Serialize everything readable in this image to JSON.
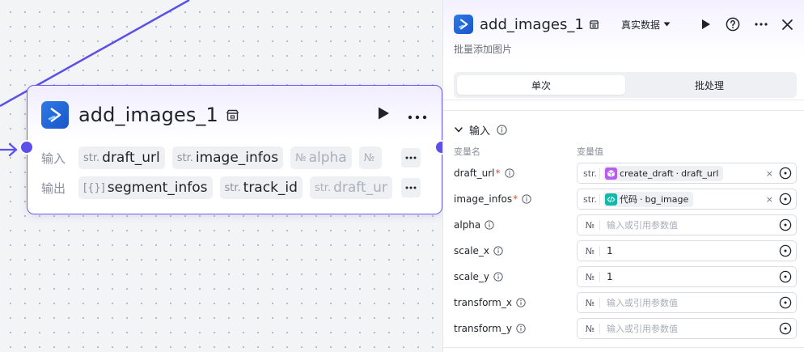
{
  "canvas": {
    "node": {
      "title": "add_images_1",
      "input_label": "输入",
      "output_label": "输出",
      "inputs": [
        {
          "type": "str.",
          "name": "draft_url"
        },
        {
          "type": "str.",
          "name": "image_infos"
        },
        {
          "type": "№",
          "name": "alpha"
        },
        {
          "type": "№",
          "name": ""
        }
      ],
      "outputs": [
        {
          "type": "[{}]",
          "name": "segment_infos"
        },
        {
          "type": "str.",
          "name": "track_id"
        },
        {
          "type": "str.",
          "name": "draft_ur"
        }
      ]
    }
  },
  "panel": {
    "title": "add_images_1",
    "subtitle": "批量添加图片",
    "data_mode": "真实数据",
    "tabs": [
      {
        "label": "单次",
        "active": true
      },
      {
        "label": "批处理",
        "active": false
      }
    ],
    "section_title": "输入",
    "col_name": "变量名",
    "col_value": "变量值",
    "params": [
      {
        "name": "draft_url",
        "required": true,
        "type": "str.",
        "kind": "ref",
        "ref_source": "create_draft",
        "ref_var": "draft_url",
        "ref_icon": "cube-icon",
        "ref_color": "#b85cf0"
      },
      {
        "name": "image_infos",
        "required": true,
        "type": "str.",
        "kind": "ref",
        "ref_source": "代码",
        "ref_var": "bg_image",
        "ref_icon": "code-icon",
        "ref_color": "#14b8a6"
      },
      {
        "name": "alpha",
        "required": false,
        "type": "№",
        "kind": "empty",
        "placeholder": "输入或引用参数值"
      },
      {
        "name": "scale_x",
        "required": false,
        "type": "№",
        "kind": "value",
        "value": "1"
      },
      {
        "name": "scale_y",
        "required": false,
        "type": "№",
        "kind": "value",
        "value": "1"
      },
      {
        "name": "transform_x",
        "required": false,
        "type": "№",
        "kind": "empty",
        "placeholder": "输入或引用参数值"
      },
      {
        "name": "transform_y",
        "required": false,
        "type": "№",
        "kind": "empty",
        "placeholder": "输入或引用参数值"
      }
    ],
    "ref_separator": " · ",
    "clear_glyph": "×"
  },
  "colors": {
    "accent": "#5b51e8",
    "node_border": "#6c5ef2",
    "required": "#e8492f"
  }
}
